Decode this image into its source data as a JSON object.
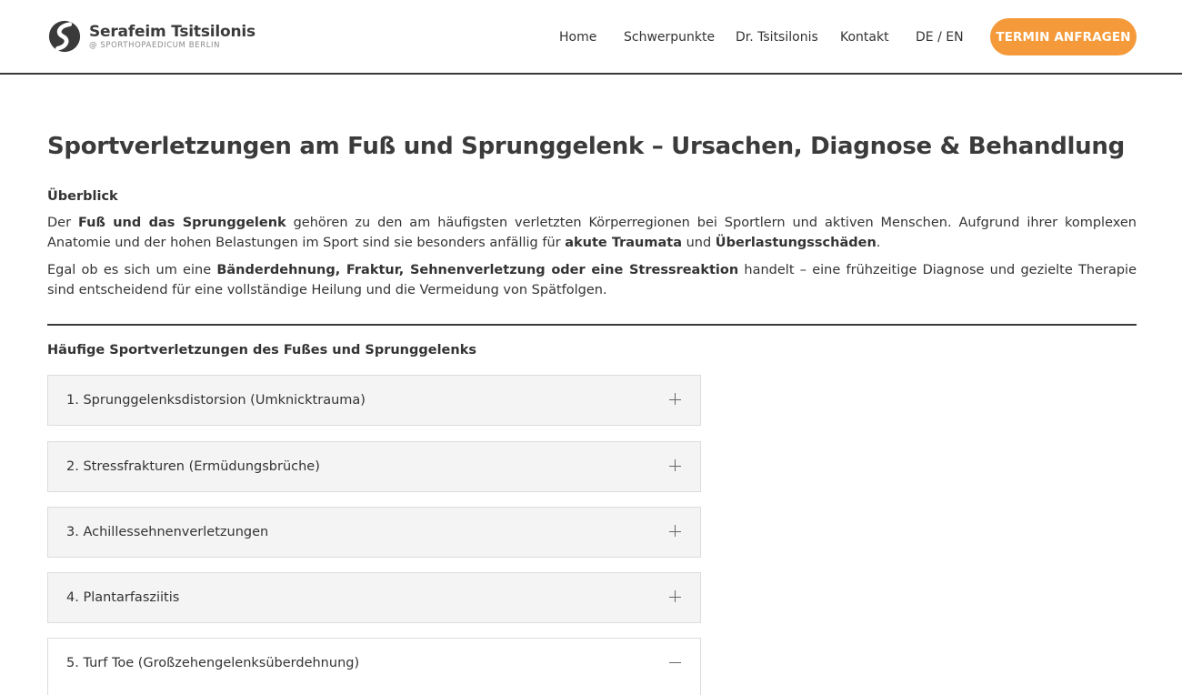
{
  "header": {
    "brand_name": "Serafeim Tsitsilonis",
    "brand_sub": "@ SPORTHOPAEDICUM BERLIN",
    "nav": [
      "Home",
      "Schwerpunkte",
      "Dr. Tsitsilonis",
      "Kontakt",
      "DE / EN"
    ],
    "cta": "TERMIN ANFRAGEN",
    "accent_color": "#f59a3a"
  },
  "main": {
    "title": "Sportverletzungen am Fuß und Sprunggelenk – Ursachen, Diagnose & Behandlung",
    "overview_heading": "Überblick",
    "p1": {
      "t1": "Der ",
      "b1": "Fuß und das Sprunggelenk",
      "t2": " gehören zu den am häufigsten verletzten Körperregionen bei Sportlern und aktiven Menschen. Aufgrund ihrer komplexen Anatomie und der hohen Belastungen im Sport sind sie besonders anfällig für ",
      "b2": "akute Traumata",
      "t3": " und ",
      "b3": "Überlastungsschäden",
      "t4": "."
    },
    "p2": {
      "t1": "Egal ob es sich um eine ",
      "b1": "Bänderdehnung, Fraktur, Sehnenverletzung oder eine Stressreaktion",
      "t2": " handelt – eine frühzeitige Diagnose und gezielte Therapie sind entscheidend für eine vollständige Heilung und die Vermeidung von Spätfolgen."
    },
    "section_heading": "Häufige Sportverletzungen des Fußes und Sprunggelenks",
    "accordion": [
      {
        "label": "1. Sprunggelenksdistorsion (Umknicktrauma)",
        "icon": "plus-icon",
        "expanded": false
      },
      {
        "label": "2. Stressfrakturen (Ermüdungsbrüche)",
        "icon": "plus-icon",
        "expanded": false
      },
      {
        "label": "3. Achillessehnenverletzungen",
        "icon": "plus-icon",
        "expanded": false
      },
      {
        "label": "4. Plantarfasziitis",
        "icon": "plus-icon",
        "expanded": false
      },
      {
        "label": "5. Turf Toe (Großzehengelenksüberdehnung)",
        "icon": "minus-icon",
        "expanded": true
      }
    ]
  }
}
